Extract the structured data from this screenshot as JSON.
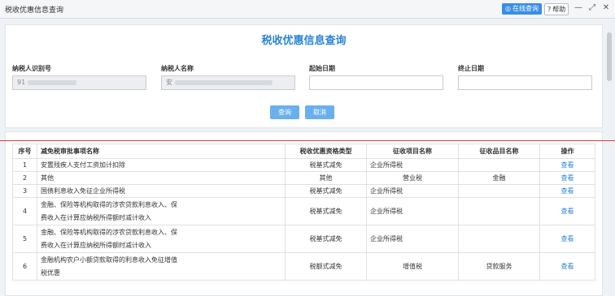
{
  "window": {
    "title": "税收优惠信息查询",
    "online_query": "在线查询",
    "help": "帮助",
    "help_icon": "?",
    "minimize": "—",
    "maximize": "⤢",
    "close": "✕"
  },
  "form": {
    "heading": "税收优惠信息查询",
    "taxpayer_id_label": "纳税人识别号",
    "taxpayer_id_value": "91",
    "taxpayer_name_label": "纳税人名称",
    "taxpayer_name_value": "安",
    "start_date_label": "起始日期",
    "start_date_value": "",
    "end_date_label": "终止日期",
    "end_date_value": "",
    "query_button": "查询",
    "cancel_button": "取消"
  },
  "table": {
    "headers": [
      "序号",
      "减免税审批事项名称",
      "税收优惠资格类型",
      "征收项目名称",
      "征收品目名称",
      "操作"
    ],
    "rows": [
      {
        "no": "1",
        "name": [
          "安置残疾人支付工资加计扣除"
        ],
        "type": "税基式减免",
        "project": "企业所得税",
        "item": "",
        "op": "查看"
      },
      {
        "no": "2",
        "name": [
          "其他"
        ],
        "type": "其他",
        "project": "营业税",
        "item": "金融",
        "op": "查看"
      },
      {
        "no": "3",
        "name": [
          "国债利息收入免征企业所得税"
        ],
        "type": "税基式减免",
        "project": "企业所得税",
        "item": "",
        "op": "查看"
      },
      {
        "no": "4",
        "name": [
          "金融、保险等机构取得的涉农贷款利息收入、保",
          "费收入在计算应纳税所得额时减计收入"
        ],
        "type": "税基式减免",
        "project": "企业所得税",
        "item": "",
        "op": "查看"
      },
      {
        "no": "5",
        "name": [
          "金融、保险等机构取得的涉农贷款利息收入、保",
          "费收入在计算应纳税所得额时减计收入"
        ],
        "type": "税基式减免",
        "project": "企业所得税",
        "item": "",
        "op": "查看"
      },
      {
        "no": "6",
        "name": [
          "金融机构农户小额贷款取得的利息收入免征增值",
          "税优惠"
        ],
        "type": "税额式减免",
        "project": "增值税",
        "item": "贷款服务",
        "op": "查看"
      }
    ]
  }
}
